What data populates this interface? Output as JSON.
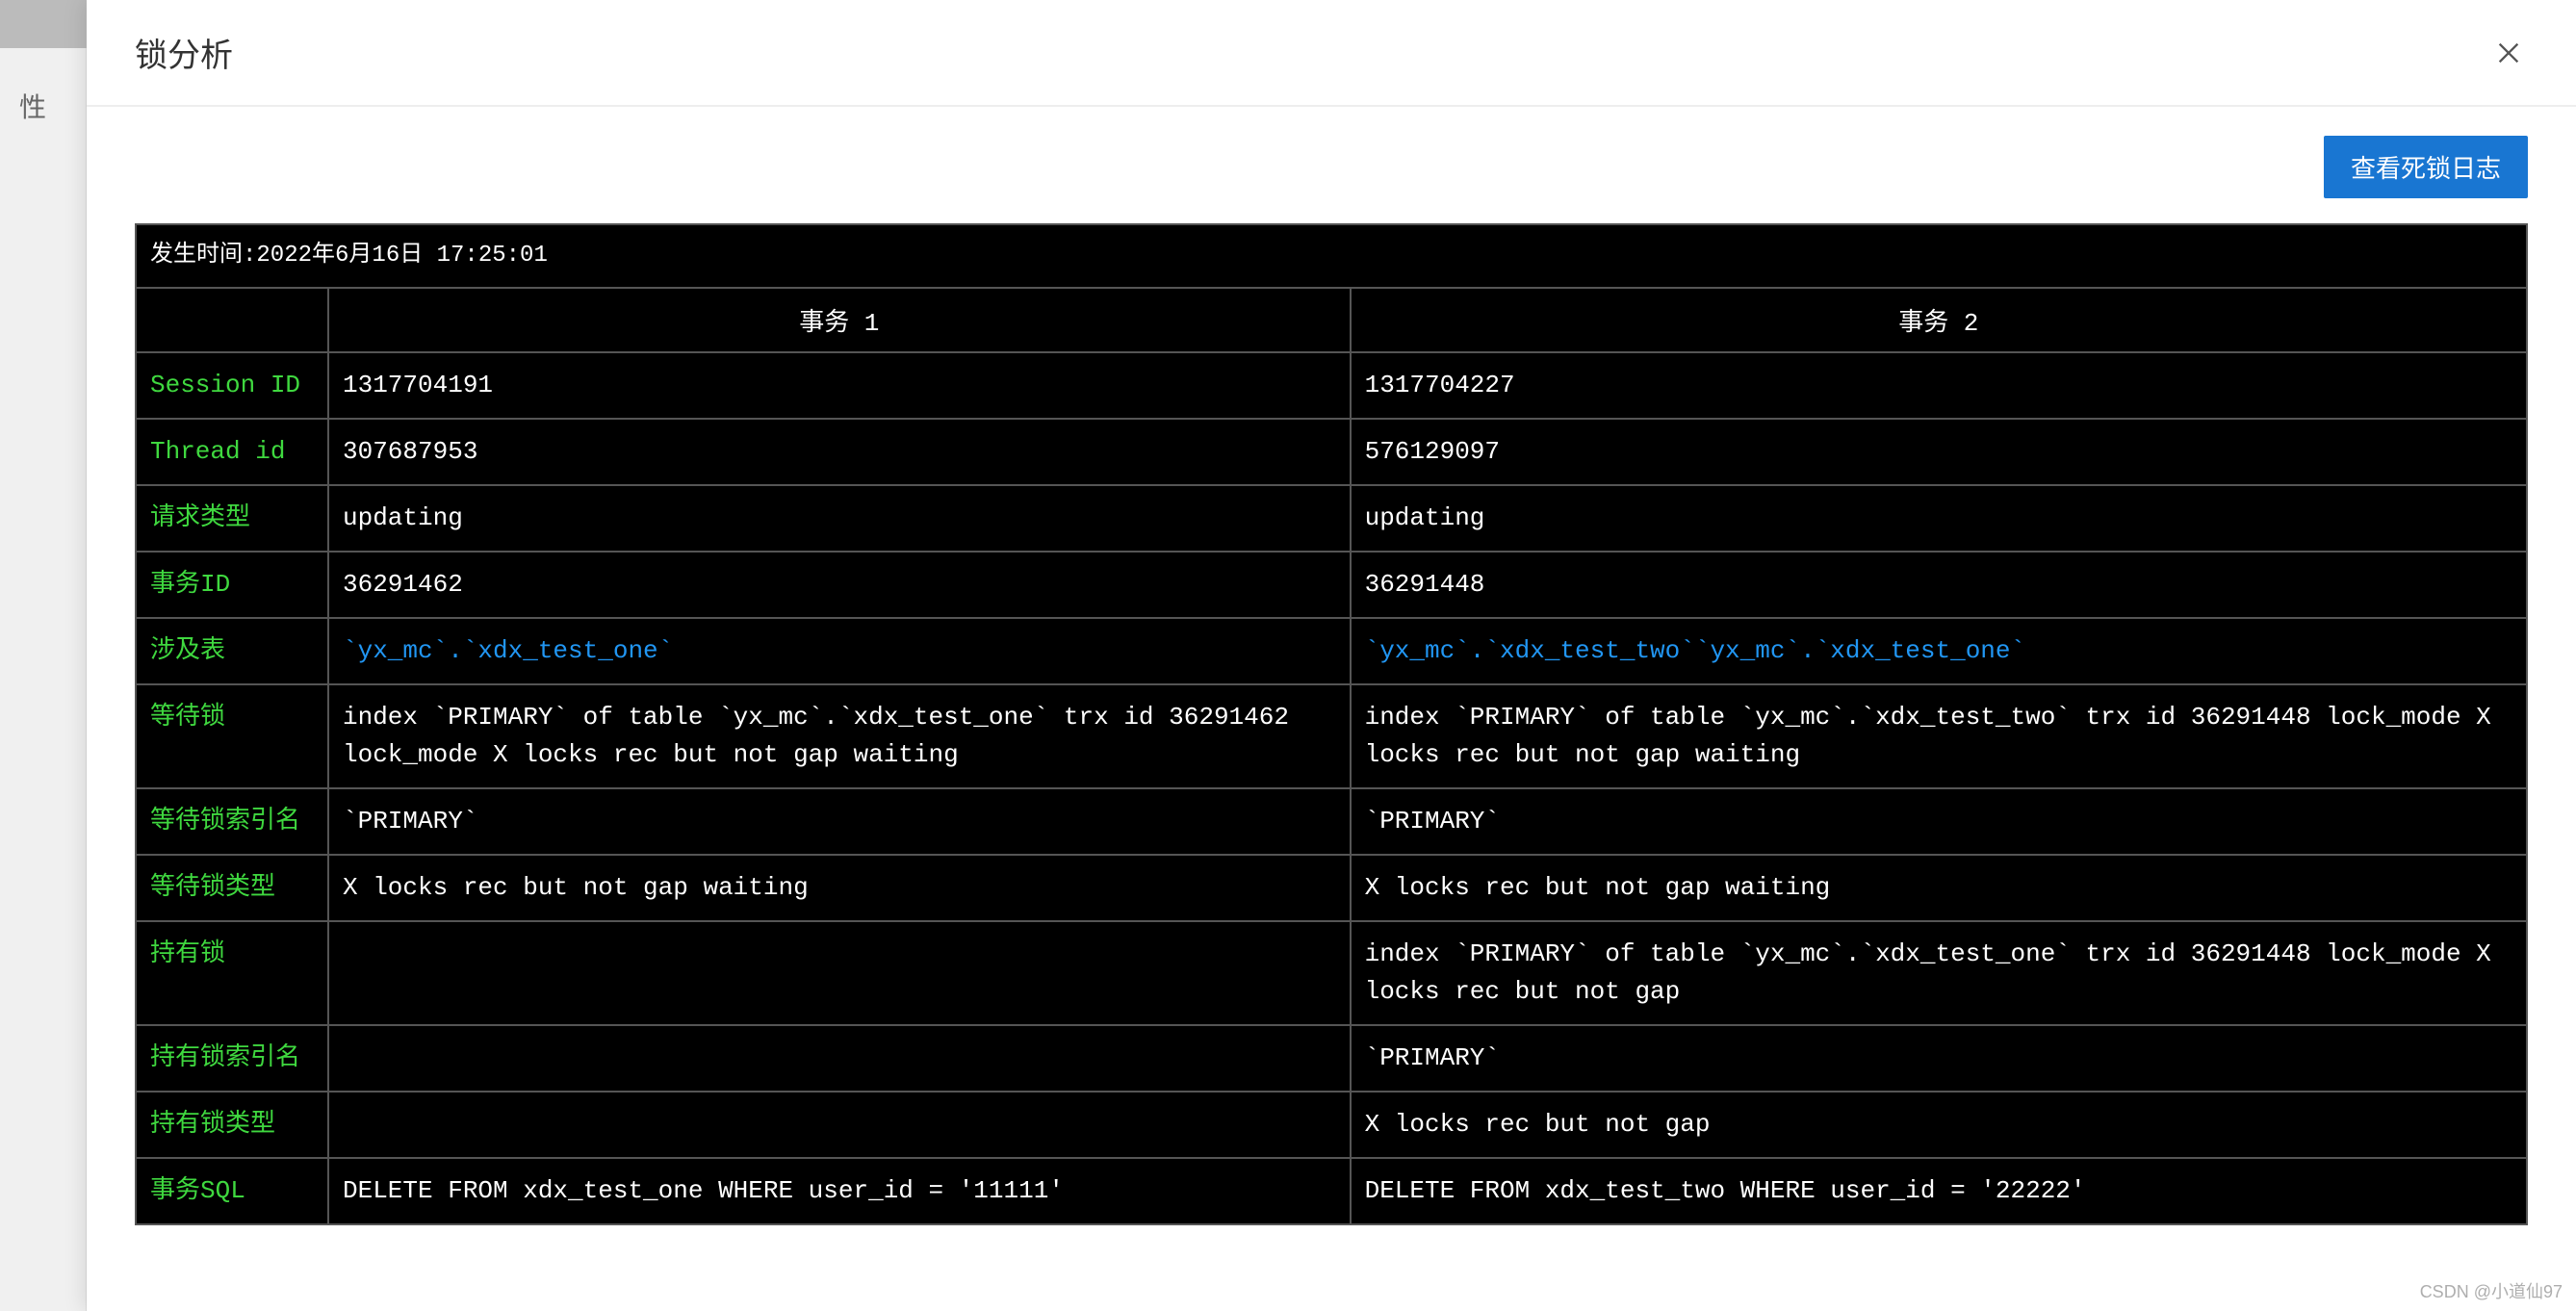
{
  "sidebar": {
    "visible_tab": "性"
  },
  "modal": {
    "title": "锁分析",
    "view_log_button": "查看死锁日志"
  },
  "deadlock": {
    "timestamp_label": "发生时间:",
    "timestamp_value": "2022年6月16日 17:25:01",
    "columns": {
      "blank": "",
      "tx1": "事务 1",
      "tx2": "事务 2"
    },
    "rows": [
      {
        "label": "Session ID",
        "tx1": "1317704191",
        "tx2": "1317704227",
        "link": false
      },
      {
        "label": "Thread id",
        "tx1": "307687953",
        "tx2": "576129097",
        "link": false
      },
      {
        "label": "请求类型",
        "tx1": "updating",
        "tx2": "updating",
        "link": false
      },
      {
        "label": "事务ID",
        "tx1": "36291462",
        "tx2": "36291448",
        "link": false
      },
      {
        "label": "涉及表",
        "tx1": "`yx_mc`.`xdx_test_one`",
        "tx2": "`yx_mc`.`xdx_test_two``yx_mc`.`xdx_test_one`",
        "link": true
      },
      {
        "label": "等待锁",
        "tx1": "index `PRIMARY` of table `yx_mc`.`xdx_test_one` trx id 36291462 lock_mode X locks rec but not gap waiting",
        "tx2": "index `PRIMARY` of table `yx_mc`.`xdx_test_two` trx id 36291448 lock_mode X locks rec but not gap waiting",
        "link": false
      },
      {
        "label": "等待锁索引名",
        "tx1": "`PRIMARY`",
        "tx2": "`PRIMARY`",
        "link": false
      },
      {
        "label": "等待锁类型",
        "tx1": "X locks rec but not gap waiting",
        "tx2": "X locks rec but not gap waiting",
        "link": false
      },
      {
        "label": "持有锁",
        "tx1": "",
        "tx2": "index `PRIMARY` of table `yx_mc`.`xdx_test_one` trx id 36291448 lock_mode X locks rec but not gap",
        "link": false
      },
      {
        "label": "持有锁索引名",
        "tx1": "",
        "tx2": "`PRIMARY`",
        "link": false
      },
      {
        "label": "持有锁类型",
        "tx1": "",
        "tx2": "X locks rec but not gap",
        "link": false
      },
      {
        "label": "事务SQL",
        "tx1": "DELETE FROM xdx_test_one WHERE user_id = '11111'",
        "tx2": "DELETE FROM xdx_test_two WHERE user_id = '22222'",
        "link": false
      }
    ]
  },
  "watermark": "CSDN @小道仙97"
}
